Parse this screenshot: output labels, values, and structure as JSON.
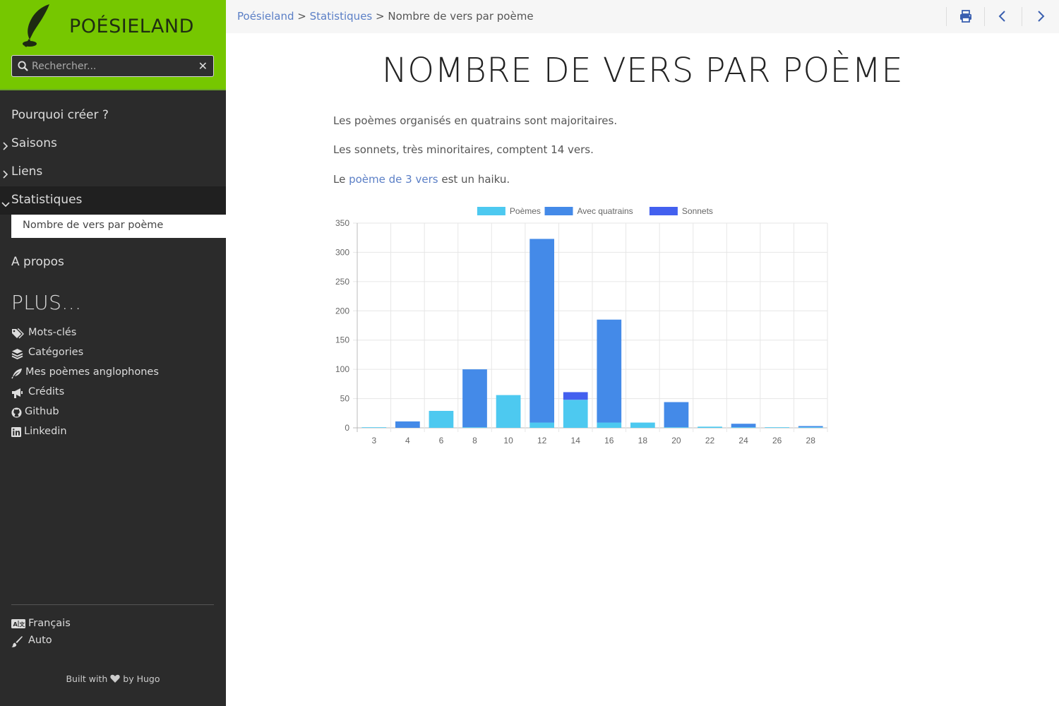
{
  "site": {
    "title": "POÉSIELAND"
  },
  "search": {
    "placeholder": "Rechercher..."
  },
  "nav": {
    "items": [
      {
        "label": "Pourquoi créer ?"
      },
      {
        "label": "Saisons"
      },
      {
        "label": "Liens"
      },
      {
        "label": "Statistiques"
      },
      {
        "label": "A propos"
      }
    ],
    "sub_item": "Nombre de vers par poème"
  },
  "plus": {
    "heading": "PLUS...",
    "items": [
      {
        "label": "Mots-clés",
        "icon": "tags-icon"
      },
      {
        "label": "Catégories",
        "icon": "layers-icon"
      },
      {
        "label": "Mes poèmes anglophones",
        "icon": "feather-icon"
      },
      {
        "label": "Crédits",
        "icon": "bullhorn-icon"
      },
      {
        "label": "Github",
        "icon": "github-icon"
      },
      {
        "label": "Linkedin",
        "icon": "linkedin-icon"
      }
    ]
  },
  "footer": {
    "language": "Français",
    "theme": "Auto",
    "built_prefix": "Built with",
    "built_suffix": "by Hugo"
  },
  "breadcrumb": {
    "root": "Poésieland",
    "sep": ">",
    "section": "Statistiques",
    "current": "Nombre de vers par poème"
  },
  "page": {
    "title": "NOMBRE DE VERS PAR POÈME",
    "p1": "Les poèmes organisés en quatrains sont majoritaires.",
    "p2": "Les sonnets, très minoritaires, comptent 14 vers.",
    "p3_prefix": "Le",
    "p3_link": "poème de 3 vers",
    "p3_suffix": "est un haiku."
  },
  "colors": {
    "accent_green": "#76c700",
    "sidebar_bg": "#2b2b2b",
    "link": "#5b7fc6"
  },
  "chart_data": {
    "type": "bar",
    "stacked": true,
    "categories": [
      "3",
      "4",
      "6",
      "8",
      "10",
      "12",
      "14",
      "16",
      "18",
      "20",
      "22",
      "24",
      "26",
      "28"
    ],
    "series": [
      {
        "name": "Poèmes",
        "color": "#4dc9f0",
        "values": [
          1,
          0,
          29,
          1,
          56,
          9,
          48,
          9,
          9,
          1,
          2,
          1,
          1,
          1
        ]
      },
      {
        "name": "Avec quatrains",
        "color": "#448ae8",
        "values": [
          0,
          11,
          0,
          99,
          0,
          314,
          0,
          176,
          0,
          43,
          0,
          6,
          0,
          2
        ]
      },
      {
        "name": "Sonnets",
        "color": "#4360ef",
        "values": [
          0,
          0,
          0,
          0,
          0,
          0,
          13,
          0,
          0,
          0,
          0,
          0,
          0,
          0
        ]
      }
    ],
    "ylim": [
      0,
      350
    ],
    "yticks": [
      0,
      50,
      100,
      150,
      200,
      250,
      300,
      350
    ],
    "grid": true,
    "legend": "top"
  }
}
